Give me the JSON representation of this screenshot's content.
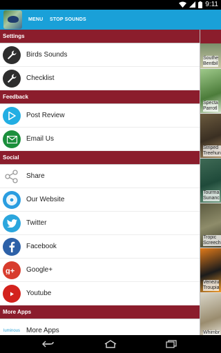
{
  "status": {
    "time": "9:11"
  },
  "toolbar": {
    "menu_label": "MENU",
    "stop_label": "STOP SOUNDS"
  },
  "sections": {
    "settings": "Settings",
    "feedback": "Feedback",
    "social": "Social",
    "more_apps": "More Apps"
  },
  "items": {
    "birds_sounds": "Birds Sounds",
    "checklist": "Checklist",
    "post_review": "Post Review",
    "email_us": "Email Us",
    "share": "Share",
    "our_website": "Our Website",
    "twitter": "Twitter",
    "facebook": "Facebook",
    "google_plus": "Google+",
    "youtube": "Youtube",
    "more_apps": "More Apps",
    "luminous_logo": "luminous"
  },
  "background_list": [
    {
      "line1": "Southe",
      "line2": "Bentbil"
    },
    {
      "line1": "Specta",
      "line2": "Parrotl"
    },
    {
      "line1": "Striped",
      "line2": "Treehun"
    },
    {
      "line1": "Tourma",
      "line2": "Sunanc"
    },
    {
      "line1": "Tropic",
      "line2": "Screech"
    },
    {
      "line1": "Venezu",
      "line2": "Troupia"
    },
    {
      "line1": "Whimbr",
      "line2": ""
    }
  ],
  "colors": {
    "action_bar": "#1aa0d8",
    "section_header": "#8b1d2c"
  }
}
